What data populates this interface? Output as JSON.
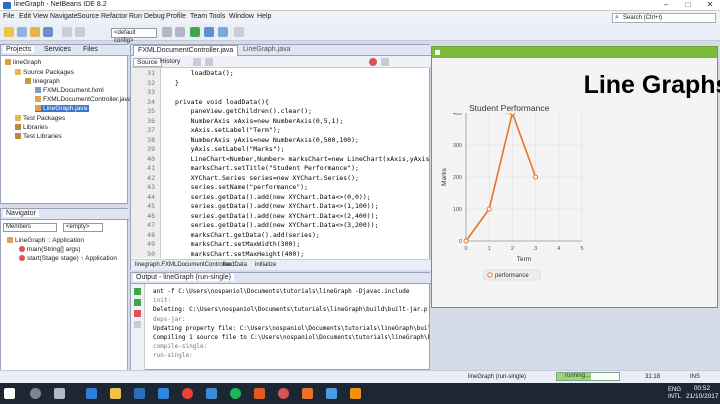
{
  "window": {
    "title": "lineGraph - NetBeans IDE 8.2"
  },
  "menu": [
    "File",
    "Edit",
    "View",
    "Navigate",
    "Source",
    "Refactor",
    "Run",
    "Debug",
    "Profile",
    "Team",
    "Tools",
    "Window",
    "Help"
  ],
  "search": {
    "placeholder": "Search (Ctrl+I)"
  },
  "toolbar": {
    "config": "<default config>"
  },
  "projects": {
    "tabs": [
      "Projects",
      "Services",
      "Files"
    ],
    "tree": [
      "lineGraph",
      "Source Packages",
      "linegraph",
      "FXMLDocument.fxml",
      "FXMLDocumentController.java",
      "LineGraph.java",
      "Test Packages",
      "Libraries",
      "Test Libraries"
    ]
  },
  "navigator": {
    "title": "Navigator",
    "members": "Members",
    "empty": "<empty>",
    "class": "LineGraph :: Application",
    "m1": "main(String[] args)",
    "m2": "start(Stage stage) ↑ Application"
  },
  "editor": {
    "tabs": [
      "FXMLDocumentController.java",
      "LineGraph.java"
    ],
    "source": "Source",
    "history": "History",
    "lines": [
      "31",
      "32",
      "33",
      "34",
      "35",
      "36",
      "37",
      "38",
      "39",
      "40",
      "41",
      "42",
      "43",
      "44",
      "45",
      "46",
      "47",
      "48",
      "49",
      "50"
    ],
    "code": [
      "    loadData();",
      "}",
      "",
      "private void loadData(){",
      "    paneView.getChildren().clear();",
      "    NumberAxis xAxis=new NumberAxis(0,5,1);",
      "    xAxis.setLabel(\"Term\");",
      "    NumberAxis yAxis=new NumberAxis(0,500,100);",
      "    yAxis.setLabel(\"Marks\");",
      "    LineChart<Number,Number> marksChart=new LineChart(xAxis,yAxis);",
      "    marksChart.setTitle(\"Student Performance\");",
      "    XYChart.Series series=new XYChart.Series();",
      "    series.setName(\"performance\");",
      "    series.getData().add(new XYChart.Data<>(0,0));",
      "    series.getData().add(new XYChart.Data<>(1,100));",
      "    series.getData().add(new XYChart.Data<>(2,400));",
      "    series.getData().add(new XYChart.Data<>(3,200));",
      "    marksChart.getData().add(series);",
      "    marksChart.setMaxWidth(300);",
      "    marksChart.setMaxHeight(400);"
    ],
    "footer": [
      "linegraph.FXMLDocumentController",
      "loadData",
      "initialize"
    ]
  },
  "output": {
    "title": "Output - lineGraph (run-single)",
    "lines": [
      "ant -f C:\\Users\\nospaniol\\Documents\\tutorials\\lineGraph -Djavac.include",
      "init:",
      "Deleting: C:\\Users\\nospaniol\\Documents\\tutorials\\lineGraph\\build\\built-jar.p",
      "deps-jar:",
      "Updating property file: C:\\Users\\nospaniol\\Documents\\tutorials\\lineGraph\\build\\built-jar.properties",
      "Compiling 1 source file to C:\\Users\\nospaniol\\Documents\\tutorials\\lineGraph\\build\\classes",
      "compile-single:",
      "run-single:"
    ]
  },
  "status": {
    "project": "lineGraph (run-single)",
    "running": "running...",
    "position": "31:18",
    "ins": "INS",
    "progress": 0.55
  },
  "taskbar": {
    "lang": "ENG",
    "intl": "INTL",
    "time": "00:52",
    "date": "21/10/2017"
  },
  "fx": {
    "heading": "Line Graphs"
  },
  "chart_data": {
    "type": "line",
    "title": "Student Performance",
    "xlabel": "Term",
    "ylabel": "Marks",
    "xlim": [
      0,
      5
    ],
    "ylim": [
      0,
      300
    ],
    "xticks": [
      "0",
      "1",
      "2",
      "3",
      "4",
      "5"
    ],
    "yticks": [
      "0",
      "100",
      "200",
      "300",
      "400"
    ],
    "series": [
      {
        "name": "performance",
        "x": [
          0,
          1,
          2,
          3
        ],
        "y": [
          0,
          100,
          400,
          200
        ]
      }
    ],
    "color": "#e8742a",
    "legend": "bottom",
    "grid": true
  }
}
